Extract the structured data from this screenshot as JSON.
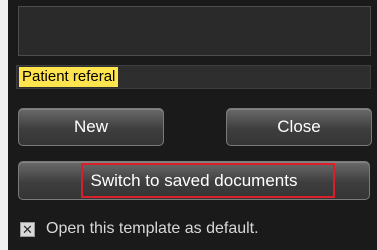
{
  "template": {
    "name": "Patient referal"
  },
  "buttons": {
    "new_label": "New",
    "close_label": "Close",
    "switch_label": "Switch to saved documents"
  },
  "default_option": {
    "label": "Open this template as default.",
    "checked": true,
    "check_glyph": "✕"
  },
  "colors": {
    "panel_bg": "#1a1a1a",
    "highlight": "#ffe44d",
    "annotation_outline": "#d81f2a"
  }
}
